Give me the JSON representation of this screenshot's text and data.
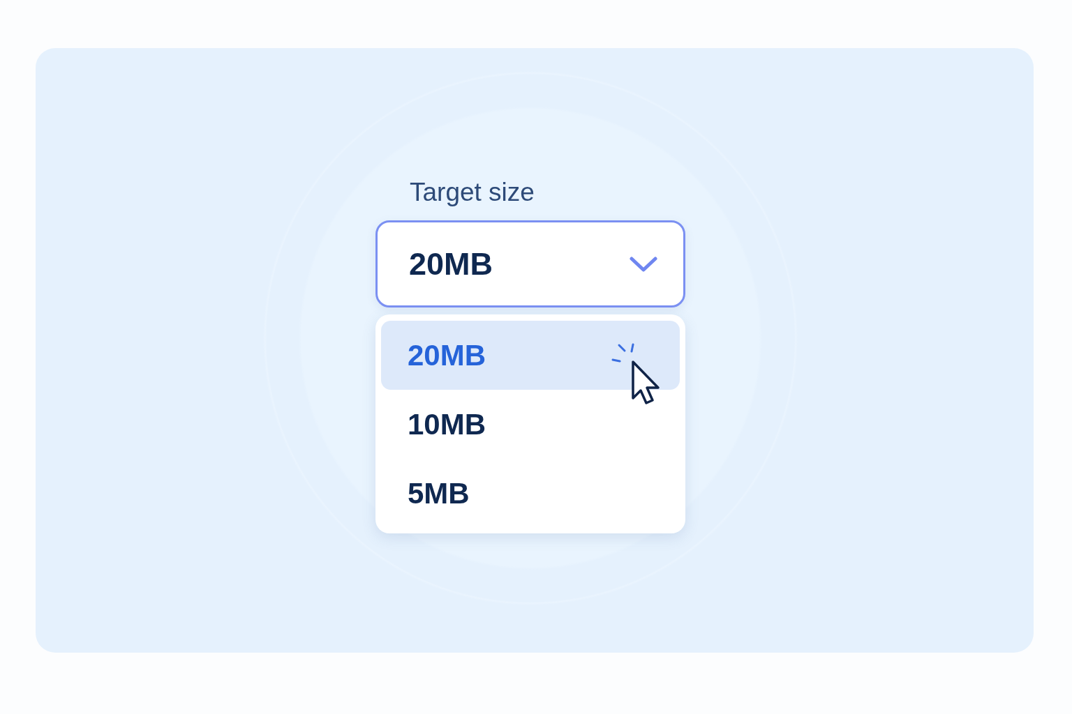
{
  "field": {
    "label": "Target size",
    "value": "20MB",
    "expanded": true
  },
  "options": [
    {
      "label": "20MB",
      "selected": true
    },
    {
      "label": "10MB",
      "selected": false
    },
    {
      "label": "5MB",
      "selected": false
    }
  ]
}
